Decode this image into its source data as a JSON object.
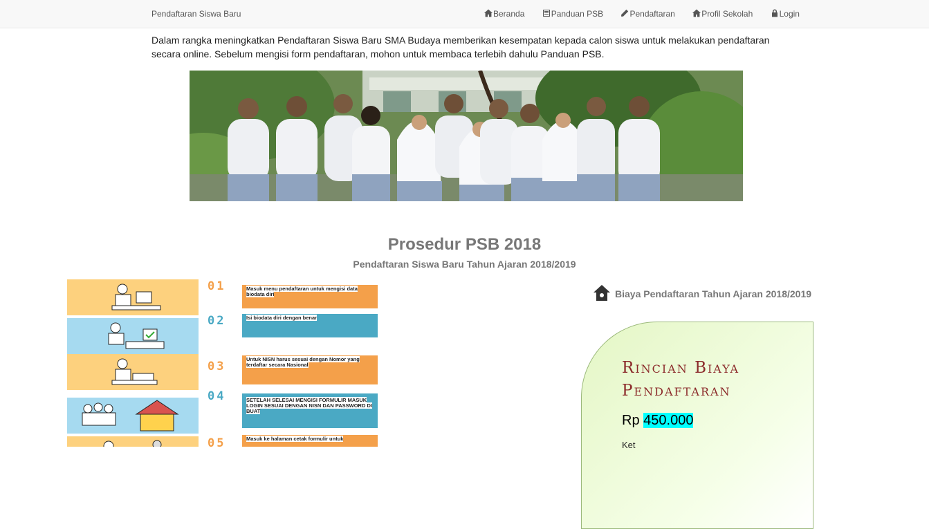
{
  "navbar": {
    "brand": "Pendaftaran Siswa Baru",
    "items": [
      {
        "label": "Beranda",
        "icon": "home-icon"
      },
      {
        "label": "Panduan PSB",
        "icon": "list-icon"
      },
      {
        "label": "Pendaftaran",
        "icon": "pencil-icon"
      },
      {
        "label": "Profil Sekolah",
        "icon": "home-icon"
      },
      {
        "label": "Login",
        "icon": "lock-icon"
      }
    ]
  },
  "intro": "Dalam rangka meningkatkan Pendaftaran Siswa Baru SMA Budaya memberikan kesempatan kepada calon siswa untuk melakukan pendaftaran secara online. Sebelum mengisi form pendaftaran, mohon untuk membaca terlebih dahulu Panduan PSB.",
  "section": {
    "title": "Prosedur PSB 2018",
    "subtitle": "Pendaftaran Siswa Baru Tahun Ajaran 2018/2019"
  },
  "steps": [
    {
      "num": "01",
      "text": "Masuk menu pendaftaran untuk mengisi data biodata diri",
      "color": "#f4a04a",
      "pic_bg": "#fdd17e"
    },
    {
      "num": "02",
      "text": "Isi biodata diri dengan benar",
      "color": "#4aa9c4",
      "pic_bg": "#a6daf0"
    },
    {
      "num": "03",
      "text": "Untuk NISN harus sesuai dengan Nomor yang terdaftar secara Nasional",
      "color": "#f4a04a",
      "pic_bg": "#fdd17e"
    },
    {
      "num": "04",
      "text": "SETELAH SELESAI MENGISI FORMULIR MASUK LOGIN SESUAI DENGAN NISN DAN PASSWORD DI BUAT",
      "color": "#4aa9c4",
      "pic_bg": "#a6daf0"
    },
    {
      "num": "05",
      "text": "Masuk ke halaman cetak formulir untuk",
      "color": "#f4a04a",
      "pic_bg": "#fdd17e"
    }
  ],
  "fee": {
    "heading": "Biaya Pendaftaran Tahun Ajaran 2018/2019",
    "card_title": "Rincian Biaya Pendaftaran",
    "currency": "Rp",
    "amount": "450.000",
    "note": "Ket"
  }
}
